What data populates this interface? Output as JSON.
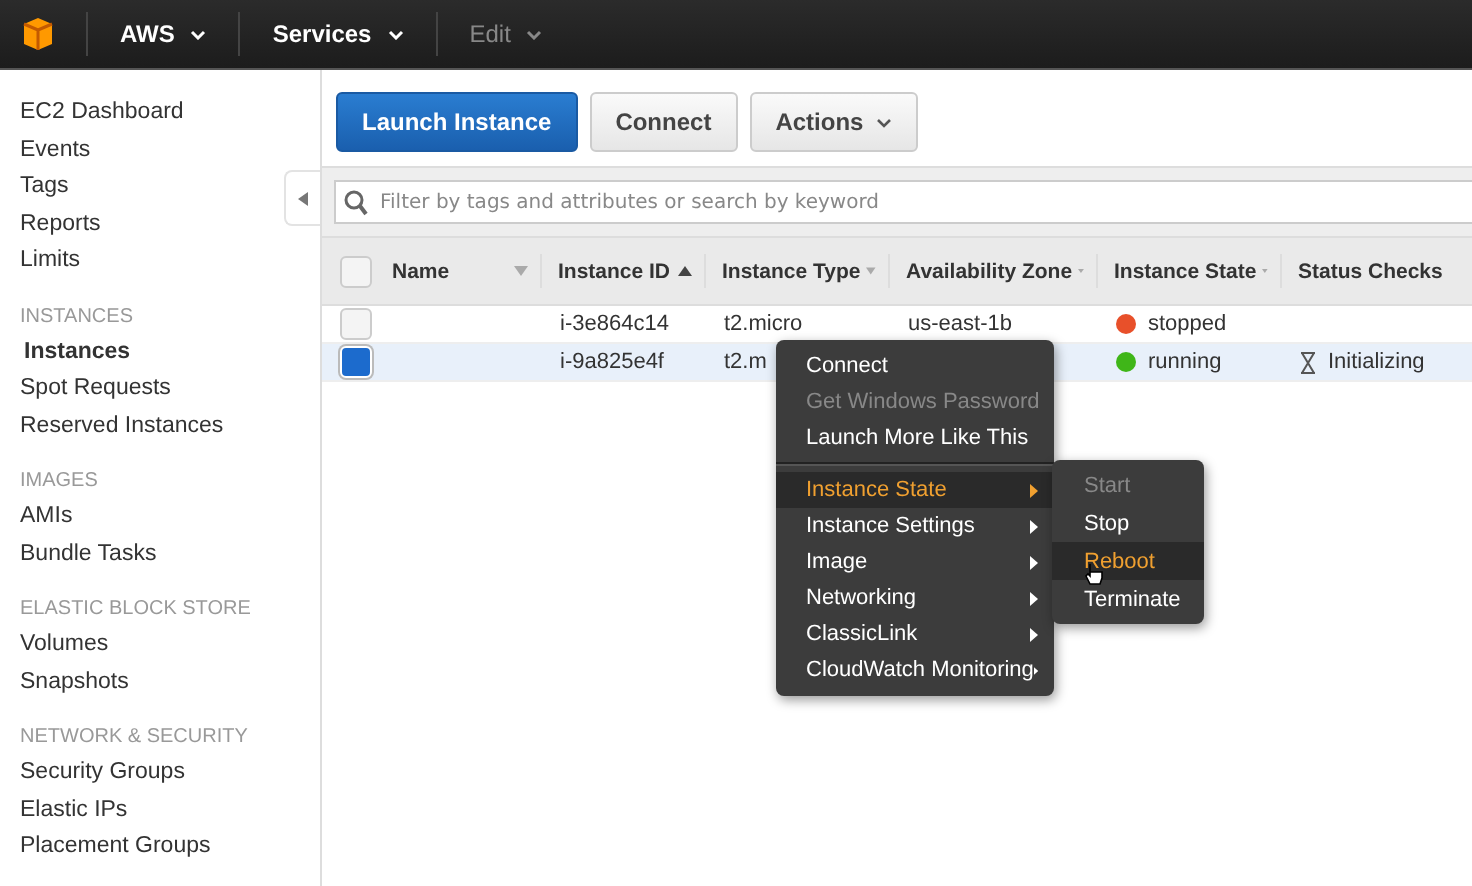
{
  "top_bar": {
    "menus": [
      {
        "label": "AWS",
        "disabled": false
      },
      {
        "label": "Services",
        "disabled": false
      },
      {
        "label": "Edit",
        "disabled": true
      }
    ]
  },
  "sidebar": {
    "groups": [
      {
        "items": [
          {
            "label": "EC2 Dashboard",
            "selected": false
          },
          {
            "label": "Events",
            "selected": false
          },
          {
            "label": "Tags",
            "selected": false
          },
          {
            "label": "Reports",
            "selected": false
          },
          {
            "label": "Limits",
            "selected": false
          }
        ]
      },
      {
        "heading": "INSTANCES",
        "items": [
          {
            "label": "Instances",
            "selected": true
          },
          {
            "label": "Spot Requests",
            "selected": false
          },
          {
            "label": "Reserved Instances",
            "selected": false
          }
        ]
      },
      {
        "heading": "IMAGES",
        "items": [
          {
            "label": "AMIs",
            "selected": false
          },
          {
            "label": "Bundle Tasks",
            "selected": false
          }
        ]
      },
      {
        "heading": "ELASTIC BLOCK STORE",
        "items": [
          {
            "label": "Volumes",
            "selected": false
          },
          {
            "label": "Snapshots",
            "selected": false
          }
        ]
      },
      {
        "heading": "NETWORK & SECURITY",
        "items": [
          {
            "label": "Security Groups",
            "selected": false
          },
          {
            "label": "Elastic IPs",
            "selected": false
          },
          {
            "label": "Placement Groups",
            "selected": false
          }
        ]
      }
    ]
  },
  "toolbar": {
    "buttons": [
      {
        "label": "Launch Instance",
        "kind": "primary"
      },
      {
        "label": "Connect",
        "kind": "plain"
      },
      {
        "label": "Actions",
        "kind": "dropdown"
      }
    ]
  },
  "search": {
    "placeholder": "Filter by tags and attributes or search by keyword"
  },
  "table": {
    "select_all": {
      "checked": false
    },
    "columns": [
      {
        "label": "Name",
        "sorted": false
      },
      {
        "label": "Instance ID",
        "sorted": true
      },
      {
        "label": "Instance Type",
        "sorted": false
      },
      {
        "label": "Availability Zone",
        "sorted": false
      },
      {
        "label": "Instance State",
        "sorted": false
      },
      {
        "label": "Status Checks",
        "sorted": false
      }
    ],
    "rows": [
      {
        "selected": false,
        "instance_id": "i-3e864c14",
        "instance_type": "t2.micro",
        "zone": "us-east-1b",
        "state": "stopped",
        "color": "#e8502a",
        "status": null
      },
      {
        "selected": true,
        "instance_id": "i-9a825e4f",
        "instance_type": "t2.m",
        "zone": null,
        "state": "running",
        "color": "#3fb618",
        "status": "Initializing"
      }
    ]
  },
  "context_menu": {
    "items": [
      {
        "label": "Connect",
        "disabled": false,
        "highlighted": false,
        "submenu": false,
        "divider_before": false
      },
      {
        "label": "Get Windows Password",
        "disabled": true,
        "highlighted": false,
        "submenu": false,
        "divider_before": false
      },
      {
        "label": "Launch More Like This",
        "disabled": false,
        "highlighted": false,
        "submenu": false,
        "divider_before": false
      },
      {
        "label": "Instance State",
        "disabled": false,
        "highlighted": true,
        "submenu": true,
        "divider_before": true
      },
      {
        "label": "Instance Settings",
        "disabled": false,
        "highlighted": false,
        "submenu": true,
        "divider_before": false
      },
      {
        "label": "Image",
        "disabled": false,
        "highlighted": false,
        "submenu": true,
        "divider_before": false
      },
      {
        "label": "Networking",
        "disabled": false,
        "highlighted": false,
        "submenu": true,
        "divider_before": false
      },
      {
        "label": "ClassicLink",
        "disabled": false,
        "highlighted": false,
        "submenu": true,
        "divider_before": false
      },
      {
        "label": "CloudWatch Monitoring",
        "disabled": false,
        "highlighted": false,
        "submenu": true,
        "divider_before": false
      }
    ],
    "submenu": [
      {
        "label": "Start",
        "disabled": true,
        "highlighted": false
      },
      {
        "label": "Stop",
        "disabled": false,
        "highlighted": false
      },
      {
        "label": "Reboot",
        "disabled": false,
        "highlighted": true
      },
      {
        "label": "Terminate",
        "disabled": false,
        "highlighted": false
      }
    ]
  }
}
